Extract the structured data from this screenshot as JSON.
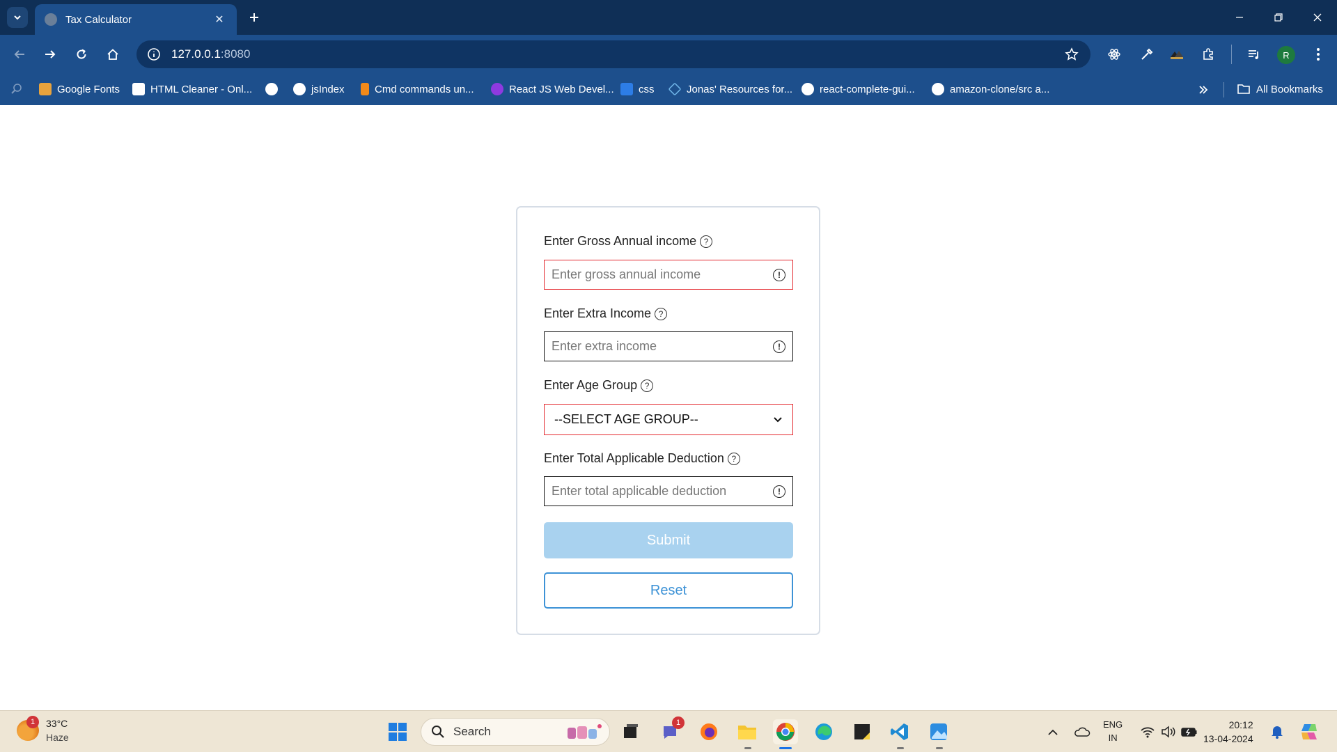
{
  "browser": {
    "tab_title": "Tax Calculator",
    "tab_close": "✕",
    "new_tab": "+",
    "url_host": "127.0.0.1",
    "url_port": ":8080",
    "profile_initial": "R",
    "bookmarks": [
      {
        "label": "Google Fonts",
        "color": "#e8a33d"
      },
      {
        "label": "HTML Cleaner - Onl...",
        "color": "#ffffff"
      },
      {
        "label": "",
        "color": "#ffffff"
      },
      {
        "label": "jsIndex",
        "color": "#ffffff"
      },
      {
        "label": "Cmd commands un...",
        "color": "#f28a1a"
      },
      {
        "label": "React JS Web Devel...",
        "color": "#8f3ae0"
      },
      {
        "label": "css",
        "color": "#2d7de6"
      },
      {
        "label": "Jonas' Resources for...",
        "color": "#6fb5e8"
      },
      {
        "label": "react-complete-gui...",
        "color": "#ffffff"
      },
      {
        "label": "amazon-clone/src a...",
        "color": "#ffffff"
      }
    ],
    "all_bookmarks": "All Bookmarks"
  },
  "form": {
    "gross_label": "Enter Gross Annual income",
    "gross_placeholder": "Enter gross annual income",
    "extra_label": "Enter Extra Income",
    "extra_placeholder": "Enter extra income",
    "age_label": "Enter Age Group",
    "age_selected": "--SELECT AGE GROUP--",
    "deduction_label": "Enter Total Applicable Deduction",
    "deduction_placeholder": "Enter total applicable deduction",
    "help_glyph": "?",
    "info_glyph": "!",
    "submit": "Submit",
    "reset": "Reset"
  },
  "taskbar": {
    "weather_temp": "33°C",
    "weather_cond": "Haze",
    "weather_badge": "1",
    "search": "Search",
    "teams_badge": "1",
    "lang_1": "ENG",
    "lang_2": "IN",
    "time": "20:12",
    "date": "13-04-2024"
  }
}
